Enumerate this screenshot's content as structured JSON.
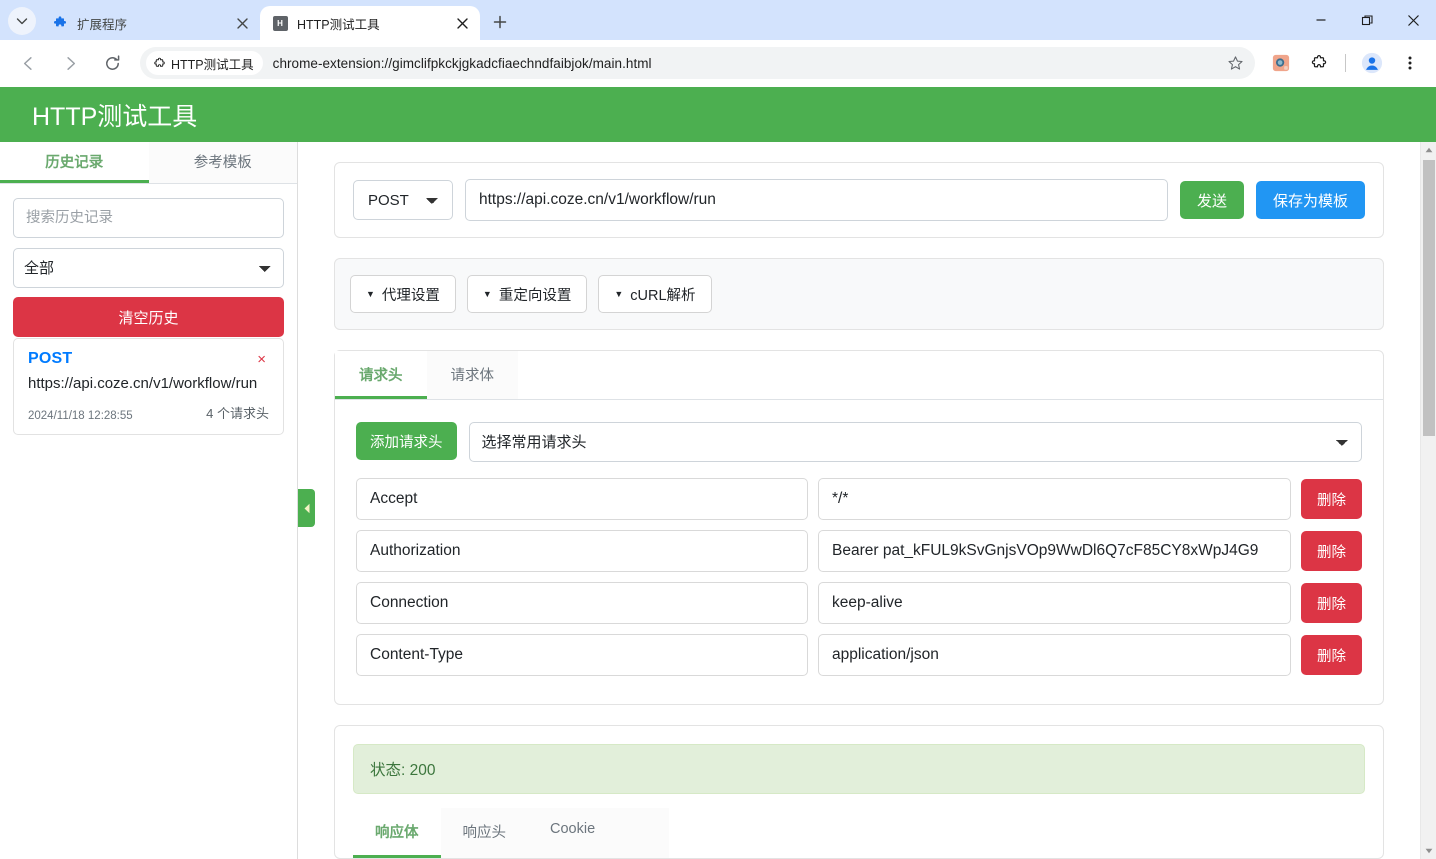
{
  "browser": {
    "tabs": [
      {
        "title": "扩展程序",
        "icon": "puzzle-icon",
        "active": false
      },
      {
        "title": "HTTP测试工具",
        "icon": "extension-letter-icon",
        "active": true
      }
    ],
    "new_tab_label": "+",
    "omnibox": {
      "origin_chip": "HTTP测试工具",
      "url": "chrome-extension://gimclifpkckjgkadcfiaechndfaibjok/main.html"
    },
    "window_controls": {
      "minimize": "—",
      "maximize": "❐",
      "close": "✕"
    }
  },
  "app": {
    "title": "HTTP测试工具",
    "accent_green": "#4CAF50",
    "danger_red": "#dc3545",
    "primary_blue": "#2196F3"
  },
  "sidebar": {
    "tabs": [
      {
        "label": "历史记录",
        "active": true
      },
      {
        "label": "参考模板",
        "active": false
      }
    ],
    "search_placeholder": "搜索历史记录",
    "search_value": "",
    "filter_selected": "全部",
    "clear_button": "清空历史",
    "history": [
      {
        "method": "POST",
        "url": "https://api.coze.cn/v1/workflow/run",
        "time": "2024/11/18 12:28:55",
        "headers_count": "4 个请求头",
        "delete": "×"
      }
    ],
    "toggle_icon": "collapse-left-icon"
  },
  "main": {
    "request": {
      "method_selected": "POST",
      "url_value": "https://api.coze.cn/v1/workflow/run",
      "send_button": "发送",
      "save_template_button": "保存为模板"
    },
    "collapse_buttons": [
      {
        "caret": "▼",
        "label": "代理设置"
      },
      {
        "caret": "▼",
        "label": "重定向设置"
      },
      {
        "caret": "▼",
        "label": "cURL解析"
      }
    ],
    "request_tabs": [
      {
        "label": "请求头",
        "active": true
      },
      {
        "label": "请求体",
        "active": false
      }
    ],
    "headers_panel": {
      "add_button": "添加请求头",
      "common_select_value": "选择常用请求头",
      "delete_label": "删除",
      "rows": [
        {
          "key": "Accept",
          "value": "*/*"
        },
        {
          "key": "Authorization",
          "value": "Bearer pat_kFUL9kSvGnjsVOp9WwDl6Q7cF85CY8xWpJ4G9"
        },
        {
          "key": "Connection",
          "value": "keep-alive"
        },
        {
          "key": "Content-Type",
          "value": "application/json"
        }
      ]
    },
    "response": {
      "status_text": "状态: 200",
      "tabs": [
        {
          "label": "响应体",
          "active": true
        },
        {
          "label": "响应头",
          "active": false
        },
        {
          "label": "Cookie",
          "active": false
        }
      ]
    }
  }
}
